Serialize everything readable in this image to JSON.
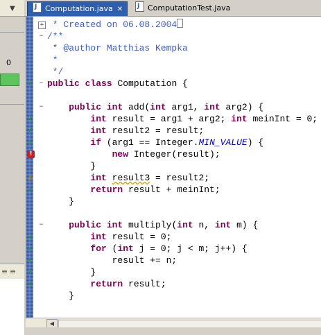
{
  "left_panel": {
    "dropdown_icon": "dropdown-arrow-icon",
    "counter": "0"
  },
  "tabs": [
    {
      "label": "Computation.java",
      "active": true,
      "close": "✕"
    },
    {
      "label": "ComputationTest.java",
      "active": false
    }
  ],
  "code_lines": [
    {
      "segments": [
        {
          "t": " * Created on 06.08.2004",
          "c": "cm"
        }
      ],
      "cursor": true
    },
    {
      "segments": [
        {
          "t": "/**",
          "c": "cm"
        }
      ]
    },
    {
      "segments": [
        {
          "t": " * @author Matthias Kempka",
          "c": "cm"
        }
      ]
    },
    {
      "segments": [
        {
          "t": " *",
          "c": "cm"
        }
      ]
    },
    {
      "segments": [
        {
          "t": " */",
          "c": "cm"
        }
      ]
    },
    {
      "segments": [
        {
          "t": "public",
          "c": "kw"
        },
        {
          "t": " "
        },
        {
          "t": "class",
          "c": "kw"
        },
        {
          "t": " Computation {"
        }
      ]
    },
    {
      "segments": [
        {
          "t": ""
        }
      ]
    },
    {
      "segments": [
        {
          "t": "    "
        },
        {
          "t": "public",
          "c": "kw"
        },
        {
          "t": " "
        },
        {
          "t": "int",
          "c": "kw"
        },
        {
          "t": " add("
        },
        {
          "t": "int",
          "c": "kw"
        },
        {
          "t": " arg1, "
        },
        {
          "t": "int",
          "c": "kw"
        },
        {
          "t": " arg2) {"
        }
      ]
    },
    {
      "segments": [
        {
          "t": "        "
        },
        {
          "t": "int",
          "c": "kw"
        },
        {
          "t": " result = arg1 + arg2; "
        },
        {
          "t": "int",
          "c": "kw"
        },
        {
          "t": " meinInt = 0;"
        }
      ]
    },
    {
      "segments": [
        {
          "t": "        "
        },
        {
          "t": "int",
          "c": "kw"
        },
        {
          "t": " result2 = result;"
        }
      ]
    },
    {
      "segments": [
        {
          "t": "        "
        },
        {
          "t": "if",
          "c": "kw"
        },
        {
          "t": " (arg1 == Integer."
        },
        {
          "t": "MIN_VALUE",
          "c": "st"
        },
        {
          "t": ") {"
        }
      ]
    },
    {
      "segments": [
        {
          "t": "            "
        },
        {
          "t": "new",
          "c": "kw"
        },
        {
          "t": " Integer(result);"
        }
      ]
    },
    {
      "segments": [
        {
          "t": "        }"
        }
      ]
    },
    {
      "segments": [
        {
          "t": "        "
        },
        {
          "t": "int",
          "c": "kw"
        },
        {
          "t": " "
        },
        {
          "t": "result3",
          "c": "wv"
        },
        {
          "t": " = result2;"
        }
      ]
    },
    {
      "segments": [
        {
          "t": "        "
        },
        {
          "t": "return",
          "c": "kw"
        },
        {
          "t": " result + meinInt;"
        }
      ]
    },
    {
      "segments": [
        {
          "t": "    }"
        }
      ]
    },
    {
      "segments": [
        {
          "t": ""
        }
      ]
    },
    {
      "segments": [
        {
          "t": "    "
        },
        {
          "t": "public",
          "c": "kw"
        },
        {
          "t": " "
        },
        {
          "t": "int",
          "c": "kw"
        },
        {
          "t": " multiply("
        },
        {
          "t": "int",
          "c": "kw"
        },
        {
          "t": " n, "
        },
        {
          "t": "int",
          "c": "kw"
        },
        {
          "t": " m) {"
        }
      ]
    },
    {
      "segments": [
        {
          "t": "        "
        },
        {
          "t": "int",
          "c": "kw"
        },
        {
          "t": " result = 0;"
        }
      ]
    },
    {
      "segments": [
        {
          "t": "        "
        },
        {
          "t": "for",
          "c": "kw"
        },
        {
          "t": " ("
        },
        {
          "t": "int",
          "c": "kw"
        },
        {
          "t": " j = 0; j < m; j++) {"
        }
      ]
    },
    {
      "segments": [
        {
          "t": "            result += n;"
        }
      ]
    },
    {
      "segments": [
        {
          "t": "        }"
        }
      ]
    },
    {
      "segments": [
        {
          "t": "        "
        },
        {
          "t": "return",
          "c": "kw"
        },
        {
          "t": " result;"
        }
      ]
    },
    {
      "segments": [
        {
          "t": "    }"
        }
      ]
    }
  ],
  "gutter": {
    "markers": [
      {
        "line": 5,
        "type": "ok",
        "icon": "checkmark-icon"
      },
      {
        "line": 8,
        "type": "ok",
        "icon": "checkmark-icon"
      },
      {
        "line": 9,
        "type": "ok",
        "icon": "checkmark-icon"
      },
      {
        "line": 10,
        "type": "ok",
        "icon": "checkmark-icon"
      },
      {
        "line": 11,
        "type": "error",
        "icon": "error-marker-icon",
        "symbol": "!"
      },
      {
        "line": 13,
        "type": "warning",
        "icon": "warning-marker-icon"
      },
      {
        "line": 14,
        "type": "ok",
        "icon": "checkmark-icon"
      },
      {
        "line": 18,
        "type": "ok",
        "icon": "checkmark-icon"
      },
      {
        "line": 19,
        "type": "ok",
        "icon": "checkmark-icon"
      },
      {
        "line": 20,
        "type": "ok",
        "icon": "checkmark-icon"
      },
      {
        "line": 21,
        "type": "ok",
        "icon": "checkmark-icon"
      },
      {
        "line": 22,
        "type": "ok",
        "icon": "checkmark-icon"
      }
    ],
    "folds": [
      {
        "line": 0,
        "symbol": "+",
        "icon": "fold-expand-icon"
      },
      {
        "line": 1,
        "symbol": "−",
        "icon": "fold-collapse-icon"
      },
      {
        "line": 5,
        "symbol": "−",
        "icon": "fold-collapse-icon"
      },
      {
        "line": 7,
        "symbol": "−",
        "icon": "fold-collapse-icon"
      },
      {
        "line": 17,
        "symbol": "−",
        "icon": "fold-collapse-icon"
      }
    ]
  },
  "scrollbar": {
    "left_arrow": "◀"
  }
}
